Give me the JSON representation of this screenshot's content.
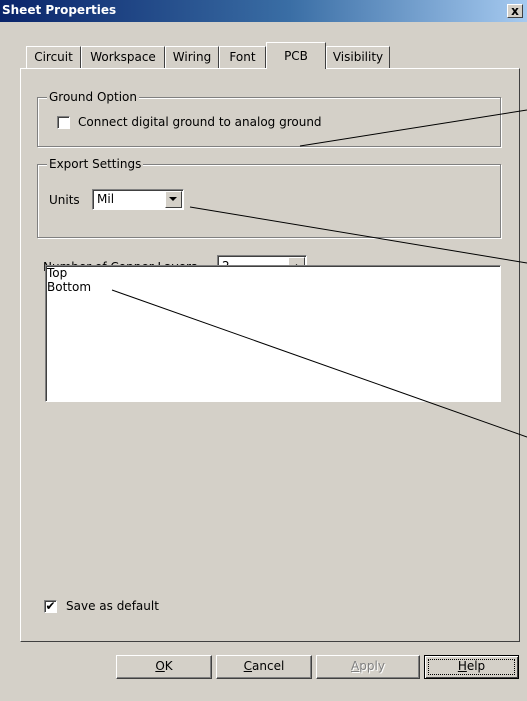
{
  "window": {
    "title": "Sheet Properties",
    "close_glyph": "x"
  },
  "tabs": [
    {
      "label": "Circuit",
      "active": false
    },
    {
      "label": "Workspace",
      "active": false
    },
    {
      "label": "Wiring",
      "active": false
    },
    {
      "label": "Font",
      "active": false
    },
    {
      "label": "PCB",
      "active": true
    },
    {
      "label": "Visibility",
      "active": false
    }
  ],
  "ground_option": {
    "group_label": "Ground Option",
    "checkbox_label": "Connect digital ground to analog ground",
    "checked": false
  },
  "export_settings": {
    "group_label": "Export Settings",
    "units_label": "Units",
    "units_value": "Mil",
    "dropdown_icon": "chevron-down-icon"
  },
  "copper_layers": {
    "label": "Number of Copper Layers",
    "value": "2"
  },
  "layers_list": [
    "Top",
    "Bottom"
  ],
  "save_default": {
    "label": "Save as default",
    "checked": true
  },
  "buttons": {
    "ok": {
      "accel": "O",
      "rest": "K"
    },
    "cancel": {
      "accel": "C",
      "rest": "ancel"
    },
    "apply": {
      "accel": "A",
      "rest": "pply"
    },
    "help": {
      "accel": "H",
      "rest": "elp"
    }
  },
  "colors": {
    "title_bar": "#0a246a",
    "face": "#d4d0c8",
    "callout_line": "#000000"
  }
}
